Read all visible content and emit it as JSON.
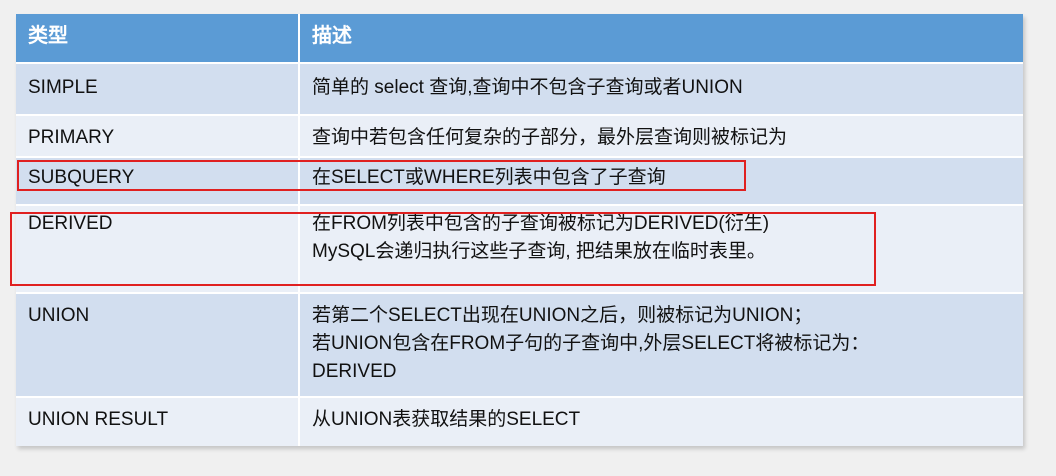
{
  "table": {
    "headers": {
      "type": "类型",
      "description": "描述"
    },
    "rows": [
      {
        "type": "SIMPLE",
        "lines": [
          "简单的 select 查询,查询中不包含子查询或者UNION"
        ]
      },
      {
        "type": "PRIMARY",
        "lines": [
          "查询中若包含任何复杂的子部分，最外层查询则被标记为"
        ]
      },
      {
        "type": "SUBQUERY",
        "lines": [
          "在SELECT或WHERE列表中包含了子查询"
        ]
      },
      {
        "type": "DERIVED",
        "lines": [
          "在FROM列表中包含的子查询被标记为DERIVED(衍生)",
          "MySQL会递归执行这些子查询, 把结果放在临时表里。"
        ]
      },
      {
        "type": "UNION",
        "lines": [
          "若第二个SELECT出现在UNION之后，则被标记为UNION；",
          "若UNION包含在FROM子句的子查询中,外层SELECT将被标记为：",
          "DERIVED"
        ]
      },
      {
        "type": "UNION RESULT",
        "lines": [
          "从UNION表获取结果的SELECT"
        ]
      }
    ]
  },
  "colors": {
    "header_bg": "#5b9bd5",
    "row_odd_bg": "#d2deef",
    "row_even_bg": "#eaeff7",
    "highlight_border": "#e02020"
  }
}
